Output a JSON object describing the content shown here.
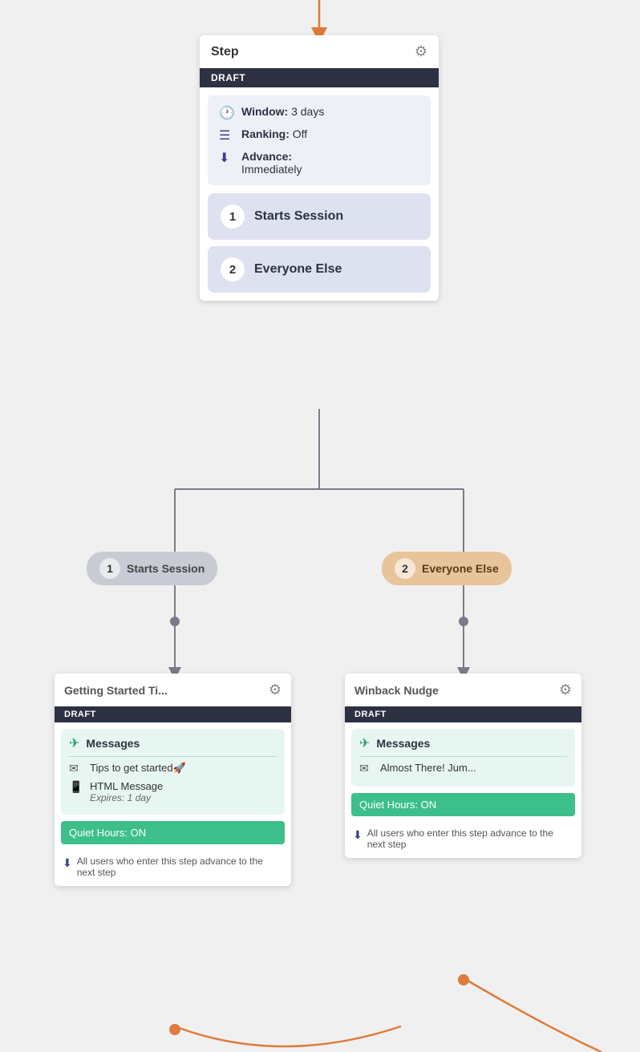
{
  "colors": {
    "draft_bg": "#2d3142",
    "info_bg": "#eef0f8",
    "group_item_bg": "#dde1f0",
    "messages_bg": "#e8f6f2",
    "quiet_hours_bg": "#3cbf8a",
    "branch_left_bg": "#c8cad4",
    "branch_right_bg": "#e8c49a",
    "orange": "#e07b39",
    "gray": "#7a7a8a"
  },
  "step_card": {
    "title": "Step",
    "draft_label": "DRAFT",
    "window_label": "Window:",
    "window_value": "3 days",
    "ranking_label": "Ranking:",
    "ranking_value": "Off",
    "advance_label": "Advance:",
    "advance_value": "Immediately",
    "group1_num": "1",
    "group1_label": "Starts Session",
    "group2_num": "2",
    "group2_label": "Everyone Else"
  },
  "branch_left": {
    "num": "1",
    "label": "Starts Session"
  },
  "branch_right": {
    "num": "2",
    "label": "Everyone Else"
  },
  "sub_card_left": {
    "title": "Getting Started Ti...",
    "draft_label": "DRAFT",
    "messages_title": "Messages",
    "msg1_text": "Tips to get started🚀",
    "msg2_text": "HTML Message",
    "msg2_sub": "Expires: 1 day",
    "quiet_hours_label": "Quiet Hours:",
    "quiet_hours_value": "ON",
    "advance_text": "All users who enter this step advance to the next step"
  },
  "sub_card_right": {
    "title": "Winback Nudge",
    "draft_label": "DRAFT",
    "messages_title": "Messages",
    "msg1_text": "Almost There! Jum...",
    "quiet_hours_label": "Quiet Hours:",
    "quiet_hours_value": "ON",
    "advance_text": "All users who enter this step advance to the next step"
  }
}
